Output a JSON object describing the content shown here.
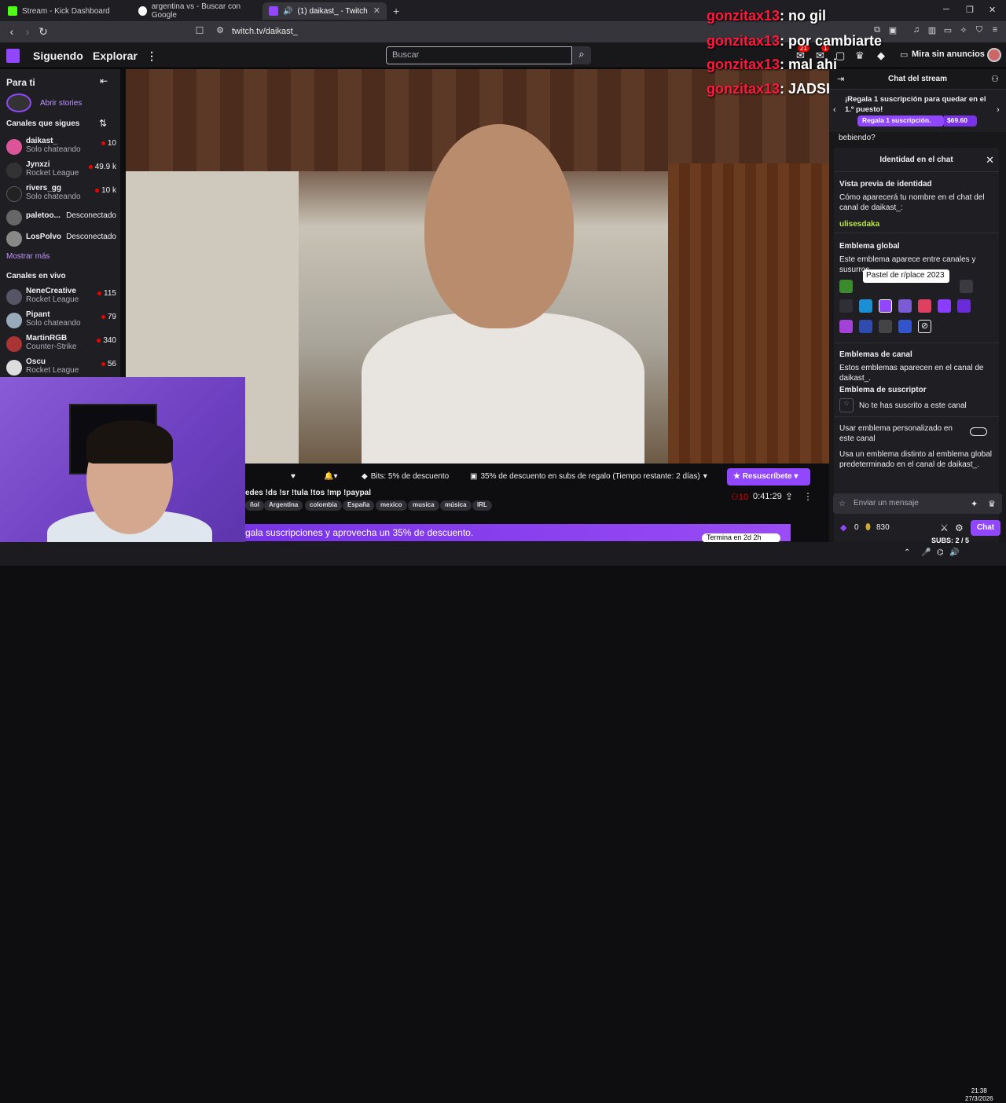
{
  "browser": {
    "tabs": [
      {
        "title": "Stream - Kick Dashboard",
        "color": "#53fc18"
      },
      {
        "title": "argentina vs - Buscar con Google",
        "color": "#ffffff"
      },
      {
        "title": "(1) daikast_ - Twitch",
        "color": "#9147ff"
      }
    ],
    "url": "twitch.tv/daikast_"
  },
  "nav": {
    "following": "Siguendo",
    "explore": "Explorar",
    "search_placeholder": "Buscar",
    "notif_count": "21",
    "inbox_count": "1",
    "ad_free": "Mira sin anuncios"
  },
  "sidebar": {
    "for_you": "Para ti",
    "stories": "Abrir stories",
    "followed_heading": "Canales que sigues",
    "followed": [
      {
        "name": "daikast_",
        "sub": "Solo chateando",
        "viewers": "10",
        "color": "#d59"
      },
      {
        "name": "Jynxzi",
        "sub": "Rocket League",
        "viewers": "49.9 k",
        "color": "#333"
      },
      {
        "name": "rivers_gg",
        "sub": "Solo chateando",
        "viewers": "10 k",
        "color": "#222"
      },
      {
        "name": "paletoo...",
        "status": "Desconectado",
        "color": "#666"
      },
      {
        "name": "LosPolvo",
        "status": "Desconectado",
        "color": "#888"
      }
    ],
    "show_more": "Mostrar más",
    "live_heading": "Canales en vivo",
    "live": [
      {
        "name": "NeneCreative",
        "sub": "Rocket League",
        "viewers": "115",
        "color": "#556"
      },
      {
        "name": "Pipant",
        "sub": "Solo chateando",
        "viewers": "79",
        "color": "#9ab"
      },
      {
        "name": "MartinRGB",
        "sub": "Counter-Strike",
        "viewers": "340",
        "color": "#a33"
      },
      {
        "name": "Oscu",
        "sub": "Rocket League",
        "viewers": "56",
        "color": "#ddd"
      }
    ]
  },
  "overlay_chat": [
    {
      "user": "gonzitax13",
      "msg": ": no gil"
    },
    {
      "user": "gonzitax13",
      "msg": ": por cambiarte"
    },
    {
      "user": "gonzitax13",
      "msg": ": mal ahi"
    },
    {
      "user": "gonzitax13",
      "msg": ": JADSKHKJASH"
    }
  ],
  "stream": {
    "bits": "Bits: 5% de descuento",
    "gift_discount": "35% de descuento en subs de regalo (Tiempo restante: 2 días)",
    "resub": "Resuscríbete",
    "title": "edes !ds !sr !tula !tos !mp !paypal",
    "tags": [
      "ñol",
      "Argentina",
      "colombia",
      "España",
      "mexico",
      "musica",
      "música",
      "IRL"
    ],
    "viewers": "10",
    "uptime": "0:41:29",
    "promo": "gala suscripciones y aprovecha un 35% de descuento.",
    "promo_end": "Termina en 2d 2h"
  },
  "chat": {
    "header": "Chat del stream",
    "gift_text": "¡Regala 1 suscripción para quedar en el 1.º puesto!",
    "gift_button": "Regala 1 suscripción.",
    "gift_price": "$69.60",
    "visible_msg": "bebiendo?",
    "identity": {
      "title": "Identidad en el chat",
      "preview_heading": "Vista previa de identidad",
      "preview_text": "Cómo aparecerá tu nombre en el chat del canal de daikast_:",
      "username": "ulisesdaka",
      "global_heading": "Emblema global",
      "global_text": "Este emblema aparece entre canales y susurros.",
      "tooltip": "Pastel de r/place 2023",
      "channel_heading": "Emblemas de canal",
      "channel_text": "Estos emblemas aparecen en el canal de daikast_.",
      "sub_heading": "Emblema de suscriptor",
      "sub_text": "No te has suscrito a este canal",
      "custom_text": "Usar emblema personalizado en este canal",
      "custom_desc": "Usa un emblema distinto al emblema global predeterminado en el canal de daikast_."
    },
    "input_placeholder": "Enviar un mensaje",
    "bits_count": "0",
    "points": "830",
    "chat_button": "Chat"
  },
  "overlay_subs": "SUBS: 2 / 5",
  "taskbar": {
    "time": "21:38",
    "date": "27/3/2026"
  }
}
